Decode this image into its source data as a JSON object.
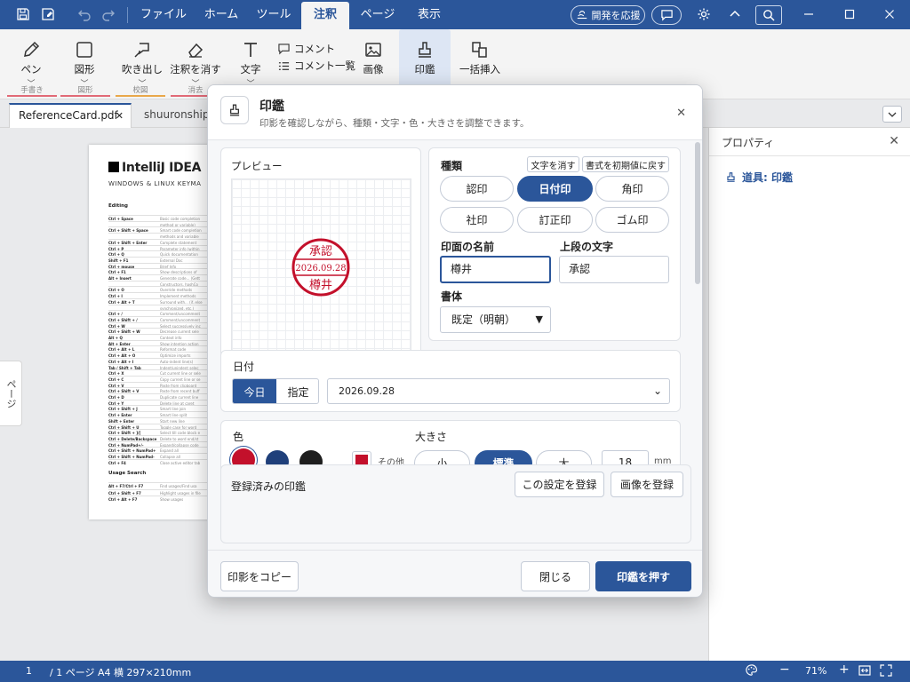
{
  "app": {
    "tabs": [
      "ファイル",
      "ホーム",
      "ツール",
      "注釈",
      "ページ",
      "表示"
    ],
    "active_tab": "注釈",
    "support_label": "開発を応援"
  },
  "ribbon": {
    "pen": "ペン",
    "shape": "図形",
    "callout": "吹き出し",
    "erase": "注釈を消す",
    "text": "文字",
    "comment": "コメント",
    "comment_list": "コメント一覧",
    "image": "画像",
    "stamp": "印鑑",
    "batch_insert": "一括挿入",
    "groups": {
      "handwriting": "手書き",
      "shape": "図形",
      "proof": "校図",
      "erase": "消去"
    }
  },
  "documents": {
    "active": "ReferenceCard.pdf",
    "other": "shuuronshipp"
  },
  "sidebar": {
    "pages_label": "ページ"
  },
  "document_page": {
    "logo": "IntelliJ IDEA",
    "subtitle": "WINDOWS & LINUX KEYMA",
    "sections": [
      "Editing",
      "Usage Search"
    ],
    "rows": [
      {
        "k": "Ctrl + Space",
        "d": "Basic code completion"
      },
      {
        "k": "",
        "d": "method or variable)"
      },
      {
        "k": "Ctrl + Shift + Space",
        "d": "Smart code completion"
      },
      {
        "k": "",
        "d": "methods and variable"
      },
      {
        "k": "Ctrl + Shift + Enter",
        "d": "Complete statement"
      },
      {
        "k": "Ctrl + P",
        "d": "Parameter info (within"
      },
      {
        "k": "Ctrl + Q",
        "d": "Quick documentation"
      },
      {
        "k": "Shift + F1",
        "d": "External Doc"
      },
      {
        "k": "Ctrl + mouse",
        "d": "Brief Info"
      },
      {
        "k": "Ctrl + F1",
        "d": "Show descriptions of"
      },
      {
        "k": "Alt + Insert",
        "d": "Generate code... (Gett"
      },
      {
        "k": "",
        "d": "Constructors, hashCo"
      },
      {
        "k": "Ctrl + O",
        "d": "Override methods"
      },
      {
        "k": "Ctrl + I",
        "d": "Implement methods"
      },
      {
        "k": "Ctrl + Alt + T",
        "d": "Surround with... (if..else"
      },
      {
        "k": "",
        "d": "synchronized, etc.)"
      },
      {
        "k": "Ctrl + /",
        "d": "Comment/uncomment"
      },
      {
        "k": "Ctrl + Shift + /",
        "d": "Comment/uncomment"
      },
      {
        "k": "Ctrl + W",
        "d": "Select successively inc"
      },
      {
        "k": "Ctrl + Shift + W",
        "d": "Decrease current sele"
      },
      {
        "k": "Alt + Q",
        "d": "Context info"
      },
      {
        "k": "Alt + Enter",
        "d": "Show intention action"
      },
      {
        "k": "Ctrl + Alt + L",
        "d": "Reformat code"
      },
      {
        "k": "Ctrl + Alt + O",
        "d": "Optimize imports"
      },
      {
        "k": "Ctrl + Alt + I",
        "d": "Auto-indent line(s)"
      },
      {
        "k": "Tab / Shift + Tab",
        "d": "Indent/unindent selec"
      },
      {
        "k": "Ctrl + X",
        "d": "Cut current line or sele"
      },
      {
        "k": "Ctrl + C",
        "d": "Copy current line or se"
      },
      {
        "k": "Ctrl + V",
        "d": "Paste from clipboard"
      },
      {
        "k": "Ctrl + Shift + V",
        "d": "Paste from recent buff"
      },
      {
        "k": "Ctrl + D",
        "d": "Duplicate current line"
      },
      {
        "k": "Ctrl + Y",
        "d": "Delete line at caret"
      },
      {
        "k": "Ctrl + Shift + J",
        "d": "Smart line join"
      },
      {
        "k": "Ctrl + Enter",
        "d": "Smart line split"
      },
      {
        "k": "Shift + Enter",
        "d": "Start new line"
      },
      {
        "k": "Ctrl + Shift + U",
        "d": "Toggle case for word"
      },
      {
        "k": "Ctrl + Shift + ]/[",
        "d": "Select till code block e"
      },
      {
        "k": "Ctrl + Delete/Backspace",
        "d": "Delete to word end/st"
      },
      {
        "k": "Ctrl + NumPad+/-",
        "d": "Expand/collapse code"
      },
      {
        "k": "Ctrl + Shift + NumPad+",
        "d": "Expand all"
      },
      {
        "k": "Ctrl + Shift + NumPad-",
        "d": "Collapse all"
      },
      {
        "k": "Ctrl + F4",
        "d": "Close active editor tab"
      }
    ],
    "usage_rows": [
      {
        "k": "Alt + F7/Ctrl + F7",
        "d": "Find usages/Find usa"
      },
      {
        "k": "Ctrl + Shift + F7",
        "d": "Highlight usages in file"
      },
      {
        "k": "Ctrl + Alt + F7",
        "d": "Show usages"
      }
    ]
  },
  "properties": {
    "title": "プロパティ",
    "tool": "道具: 印鑑"
  },
  "dialog": {
    "title": "印鑑",
    "subtitle": "印影を確認しながら、種類・文字・色・大きさを調整できます。",
    "preview_label": "プレビュー",
    "stamp_top": "承認",
    "stamp_date": "2026.09.28",
    "stamp_name": "樽井",
    "kind_label": "種類",
    "clear_text": "文字を消す",
    "reset_format": "書式を初期値に戻す",
    "kinds": [
      "認印",
      "日付印",
      "角印",
      "社印",
      "訂正印",
      "ゴム印"
    ],
    "active_kind": "日付印",
    "name_label": "印面の名前",
    "name_value": "樽井",
    "top_text_label": "上段の文字",
    "top_text_value": "承認",
    "font_label": "書体",
    "font_value": "既定（明朝）",
    "date_label": "日付",
    "today": "今日",
    "specify": "指定",
    "date_value": "2026.09.28",
    "color_label": "色",
    "colors": [
      "#c3102b",
      "#1f3f7a",
      "#1e1e1e"
    ],
    "other_color": "その他",
    "size_label": "大きさ",
    "sizes": [
      "小",
      "標準",
      "大"
    ],
    "active_size": "標準",
    "size_value": "18",
    "size_unit": "mm",
    "registered_label": "登録済みの印鑑",
    "register_setting": "この設定を登録",
    "register_image": "画像を登録",
    "copy_stamp": "印影をコピー",
    "close": "閉じる",
    "apply": "印鑑を押す"
  },
  "status": {
    "page_current": "1",
    "page_total": "/ 1 ページ",
    "paper": "A4 横 297×210mm",
    "zoom": "71%"
  },
  "colors": {
    "accent": "#2b569a",
    "stamp_red": "#c3102b"
  }
}
